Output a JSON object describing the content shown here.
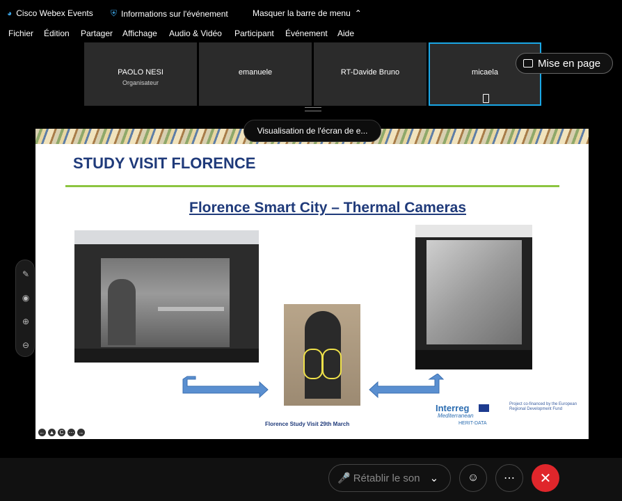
{
  "titlebar": {
    "app_name": "Cisco Webex Events",
    "event_info": "Informations sur l'événement",
    "hide_menu": "Masquer la barre de menu"
  },
  "menu": [
    "Fichier",
    "Édition",
    "Partager",
    "Affichage",
    "Audio & Vidéo",
    "Participant",
    "Événement",
    "Aide"
  ],
  "participants": [
    {
      "name": "PAOLO NESI",
      "role": "Organisateur"
    },
    {
      "name": "emanuele",
      "role": ""
    },
    {
      "name": "RT-Davide Bruno",
      "role": ""
    },
    {
      "name": "micaela",
      "role": ""
    }
  ],
  "layout_button": "Mise en page",
  "share_banner": "Visualisation de l'écran de e...",
  "slide": {
    "title": "STUDY VISIT FLORENCE",
    "subtitle": "Florence Smart City – Thermal Cameras",
    "footer": "Florence Study Visit  29th March",
    "interreg": "Interreg",
    "mediterranean": "Mediterranean",
    "herit": "HERIT-DATA",
    "funding": "Project co-financed by the European Regional Development Fund"
  },
  "controls": {
    "unmute_label": "Rétablir le son"
  },
  "colors": {
    "accent": "#1aa7e6",
    "end_call": "#e0262b",
    "slide_title": "#1f3a7a",
    "slide_rule": "#8cc540"
  }
}
